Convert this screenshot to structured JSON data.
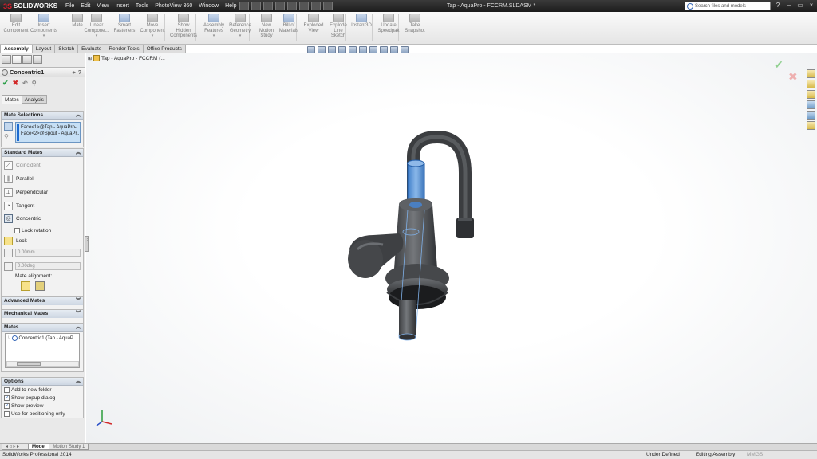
{
  "app": {
    "name": "SOLIDWORKS",
    "menus": [
      "File",
      "Edit",
      "View",
      "Insert",
      "Tools",
      "PhotoView 360",
      "Window",
      "Help"
    ],
    "document_title": "Tap - AquaPro - FCCRM.SLDASM *",
    "search_placeholder": "Search files and models"
  },
  "commands": [
    {
      "label": "Edit\nComponent"
    },
    {
      "label": "Insert\nComponents"
    },
    {
      "label": "Mate"
    },
    {
      "label": "Linear\nCompone..."
    },
    {
      "label": "Smart\nFasteners"
    },
    {
      "label": "Move\nComponent"
    },
    {
      "label": "Show\nHidden\nComponents"
    },
    {
      "label": "Assembly\nFeatures"
    },
    {
      "label": "Reference\nGeometry"
    },
    {
      "label": "New\nMotion\nStudy"
    },
    {
      "label": "Bill of\nMaterials"
    },
    {
      "label": "Exploded\nView"
    },
    {
      "label": "Explode\nLine\nSketch"
    },
    {
      "label": "Instant3D"
    },
    {
      "label": "Update\nSpeedpak"
    },
    {
      "label": "Take\nSnapshot"
    }
  ],
  "cm_tabs": [
    "Assembly",
    "Layout",
    "Sketch",
    "Evaluate",
    "Render Tools",
    "Office Products"
  ],
  "property_manager": {
    "title": "Concentric1",
    "subtabs": [
      "Mates",
      "Analysis"
    ],
    "mate_selections": {
      "header": "Mate Selections",
      "items": [
        "Face<1>@Tap - AquaPro-...",
        "Face<2>@Spout - AquaPr..."
      ]
    },
    "standard_mates": {
      "header": "Standard Mates",
      "items": [
        "Coincident",
        "Parallel",
        "Perpendicular",
        "Tangent",
        "Concentric"
      ],
      "lock_rotation": "Lock rotation",
      "lock": "Lock",
      "distance_value": "0.00mm",
      "angle_value": "0.00deg",
      "mate_alignment": "Mate alignment:"
    },
    "advanced_mates": "Advanced Mates",
    "mechanical_mates": "Mechanical Mates",
    "mates": {
      "header": "Mates",
      "items": [
        "Concentric1 (Tap - AquaP"
      ]
    },
    "options": {
      "header": "Options",
      "items": [
        {
          "label": "Add to new folder",
          "checked": false
        },
        {
          "label": "Show popup dialog",
          "checked": true
        },
        {
          "label": "Show preview",
          "checked": true
        },
        {
          "label": "Use for positioning only",
          "checked": false
        }
      ]
    }
  },
  "graphics": {
    "tree_root": "Tap - AquaPro - FCCRM  (..."
  },
  "bottom_tabs": [
    "Model",
    "Motion Study 1"
  ],
  "status": {
    "product": "SolidWorks Professional 2014",
    "state": "Under Defined",
    "mode": "Editing Assembly",
    "units": "MMGS"
  }
}
